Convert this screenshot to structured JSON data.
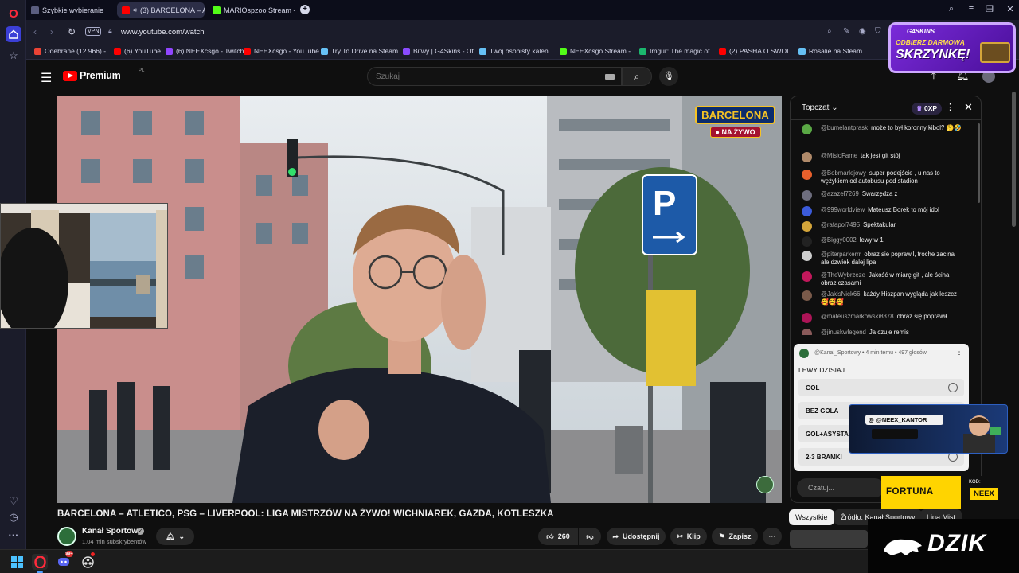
{
  "browser": {
    "tabs": [
      {
        "label": "Szybkie wybieranie",
        "active": false
      },
      {
        "label": "(3) BARCELONA – ATL",
        "active": true
      },
      {
        "label": "MARIOspzoo Stream - W",
        "active": false
      }
    ],
    "new_tab_label": "+",
    "vpn_label": "VPN",
    "url": "www.youtube.com/watch",
    "bookmarks": [
      {
        "label": "Odebrane (12 966) -",
        "color": "#ea4335"
      },
      {
        "label": "(6) YouTube",
        "color": "#ff0000"
      },
      {
        "label": "(6) NEEXcsgo - Twitch",
        "color": "#9146ff"
      },
      {
        "label": "NEEXcsgo - YouTube",
        "color": "#ff0000"
      },
      {
        "label": "Try To Drive na Steam",
        "color": "#66c0f4"
      },
      {
        "label": "Bitwy | G4Skins - Ot...",
        "color": "#8a4bff"
      },
      {
        "label": "Twój osobisty kalen...",
        "color": "#66c0f4"
      },
      {
        "label": "NEEXcsgo Stream -...",
        "color": "#53fc18"
      },
      {
        "label": "Imgur: The magic of...",
        "color": "#1bb76e"
      },
      {
        "label": "(2) PASHA O SWOI...",
        "color": "#ff0000"
      },
      {
        "label": "Rosalie na Steam",
        "color": "#66c0f4"
      }
    ]
  },
  "youtube": {
    "logo_text": "Premium",
    "logo_country": "PL",
    "search_placeholder": "Szukaj",
    "video_badge_title": "BARCELONA",
    "video_badge_live": "● NA ŻYWO",
    "video_title": "BARCELONA – ATLETICO, PSG – LIVERPOOL: LIGA MISTRZÓW NA ŻYWO! WICHNIAREK, GAZDA, KOTLESZKA",
    "channel_name": "Kanał Sportowy",
    "subscribers": "1,04 mln subskrybentów",
    "likes": "260",
    "share_label": "Udostępnij",
    "clip_label": "Klip",
    "save_label": "Zapisz",
    "chips": [
      "Wszystkie",
      "Źródło: Kanał Sportowy",
      "Liga Mist"
    ]
  },
  "chat": {
    "mode_label": "Topczat",
    "xp_label": "0XP",
    "messages": [
      {
        "author": "@bumelantprask",
        "text": "może to był koronny kibol? 🤔🤣",
        "color": "#5aa845"
      },
      {
        "author": "@MisioFame",
        "text": "tak jest git stój",
        "color": "#b08a6a"
      },
      {
        "author": "@Bobmarlejowy",
        "text": "super podejście , u nas to wężykiem od autobusu pod stadion",
        "color": "#e8602c"
      },
      {
        "author": "@azazel7269",
        "text": "Swarzędza z",
        "color": "#6d6d7e"
      },
      {
        "author": "@999worldview",
        "text": "Mateusz Borek to mój idol",
        "color": "#3b5bdb"
      },
      {
        "author": "@rafapol7495",
        "text": "Spektakular",
        "color": "#d4a53a"
      },
      {
        "author": "@Biggy0002",
        "text": "lewy w 1",
        "color": "#222222"
      },
      {
        "author": "@piterparkerrr",
        "text": "obraz sie poprawil, troche zacina ale dzwiek dalej lipa",
        "color": "#cccccc"
      },
      {
        "author": "@TheWybrzeze",
        "text": "Jakość w miarę git , ale ścina obraz czasami",
        "color": "#c2185b"
      },
      {
        "author": "@JakisNick66",
        "text": "każdy Hiszpan wygląda jak leszcz 🥰🥰🥰",
        "color": "#7a5a4a"
      },
      {
        "author": "@mateuszmarkowski8378",
        "text": "obraz się poprawił",
        "color": "#ad1457"
      },
      {
        "author": "@jinuskwlegend",
        "text": "Ja czuje remis",
        "color": "#8a5a5a"
      }
    ],
    "poll": {
      "meta": "@Kanal_Sportowy • 4 min temu • 497 głosów",
      "question": "LEWY DZISIAJ",
      "options": [
        "GOL",
        "BEZ GOLA",
        "GOL+ASYSTA",
        "2-3 BRAMKI"
      ]
    },
    "input_placeholder": "Czatuj..."
  },
  "overlays": {
    "promo_brand": "G4SKINS",
    "promo_line1": "ODBIERZ DARMOWĄ",
    "promo_line2": "SKRZYNKĘ!",
    "instagram_handle": "@NEEX_KANTOR",
    "fortuna_name": "FORTUNA",
    "fortuna_code_label": "KOD:",
    "fortuna_code": "NEEX",
    "dzik_text": "DZIK"
  },
  "taskbar": {
    "discord_badge": "99+"
  },
  "colors": {
    "yt_red": "#ff0000",
    "opera_red": "#ff2a3b",
    "opera_accent": "#3b3fd6",
    "fortuna_yellow": "#ffd400",
    "barca_gold": "#f6c324",
    "barca_blue": "#0c2c6c"
  }
}
